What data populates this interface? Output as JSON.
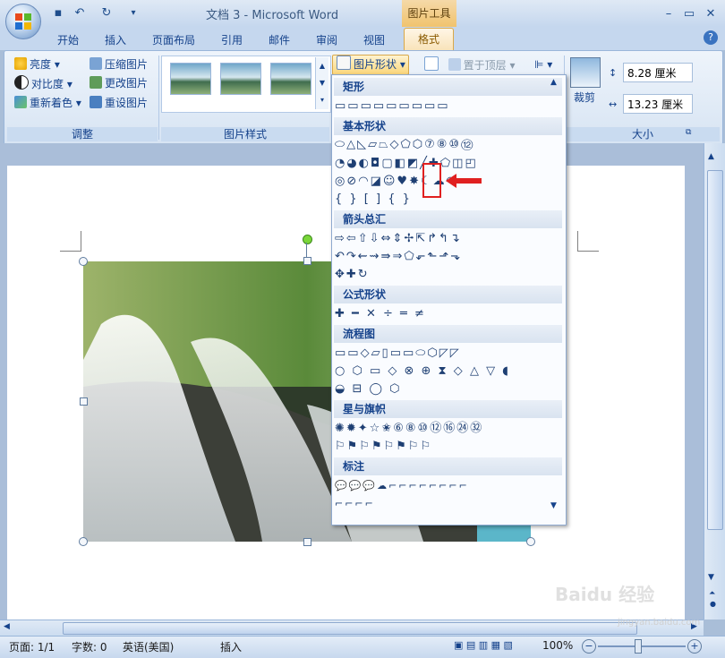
{
  "title_bar": {
    "doc_title": "文档 3 - Microsoft Word",
    "context_tab_title": "图片工具",
    "qat": [
      "save-icon",
      "undo-icon",
      "redo-icon",
      "customize-icon"
    ],
    "window_buttons": [
      "–",
      "▭",
      "✕"
    ]
  },
  "tabs": [
    "开始",
    "插入",
    "页面布局",
    "引用",
    "邮件",
    "审阅",
    "视图"
  ],
  "active_tab": "格式",
  "ribbon": {
    "adjust": {
      "items": [
        "亮度 ▾",
        "对比度 ▾",
        "重新着色 ▾",
        "压缩图片",
        "更改图片",
        "重设图片"
      ],
      "label": "调整"
    },
    "picture_styles": {
      "label": "图片样式"
    },
    "arrange": {
      "shape_button": "图片形状 ▾",
      "bring_front": "置于顶层 ▾"
    },
    "size": {
      "crop": "裁剪",
      "height": "8.28 厘米",
      "width": "13.23 厘米",
      "label": "大小"
    }
  },
  "shapes_menu": {
    "categories": [
      "矩形",
      "基本形状",
      "箭头总汇",
      "公式形状",
      "流程图",
      "星与旗帜",
      "标注"
    ],
    "rows": [
      "▭▭▭▭▭▭▭▭▭",
      "⬭△◺▱⏢◇⬠⬡⑦⑧⑩⑫",
      "◔◕◐◘▢◧◩╱✚⬠◫◰",
      "◎⊘◠◪☺♥✸☾☁◜◝",
      "{ } [ ] { }",
      "⇨⇦⇧⇩⇔⇕✢⇱↱↰↴",
      "↶↷⇜⇝⇛⇒⬠⬐⬑⬏⬎",
      "✥✚↻",
      "✚ ━ ✕ ÷ ═ ≠",
      "▭▭◇▱▯▭▭⬭⬡◸◸",
      "○ ⬡ ▭ ◇ ⊗ ⊕ ⧗ ◇ △ ▽ ◖",
      "◒ ⊟ ◯ ⬡",
      "✺✹✦☆✬⑥⑧⑩⑫⑯㉔㉜",
      "⚐⚑⚐⚑⚐⚑⚐⚐",
      "💬💬💬☁⌐⌐⌐⌐⌐⌐⌐⌐",
      "⌐⌐⌐⌐"
    ]
  },
  "status_bar": {
    "page": "页面: 1/1",
    "words": "字数: 0",
    "language": "英语(美国)",
    "mode": "插入",
    "zoom": "100%"
  },
  "watermark": "Baidu 经验",
  "watermark_url": "jingyan.baidu.com"
}
